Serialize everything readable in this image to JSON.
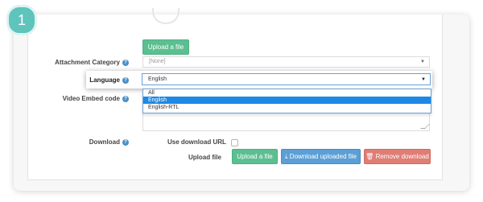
{
  "step_number": "1",
  "upload_top_label": "Upload a file",
  "attachment_category": {
    "label": "Attachment Category",
    "value": "[None]"
  },
  "language": {
    "label": "Language",
    "value": "English",
    "options": [
      "All",
      "English",
      "English-RTL"
    ],
    "selected_option": "English"
  },
  "video_embed": {
    "label": "Video Embed code"
  },
  "download": {
    "label": "Download",
    "use_download_url_label": "Use download URL",
    "upload_file_label": "Upload file",
    "upload_button": "Upload a file",
    "download_button": "Download uploaded file",
    "remove_button": "Remove download"
  },
  "colors": {
    "step_badge": "#5ec4bc",
    "green_button": "#5cbf91",
    "blue_button": "#5b9fd6",
    "red_button": "#e07d75",
    "selected_option": "#1e88e5",
    "help_icon": "#4a90c7"
  },
  "icons": {
    "help": "question-circle",
    "download": "download",
    "remove": "trash"
  }
}
